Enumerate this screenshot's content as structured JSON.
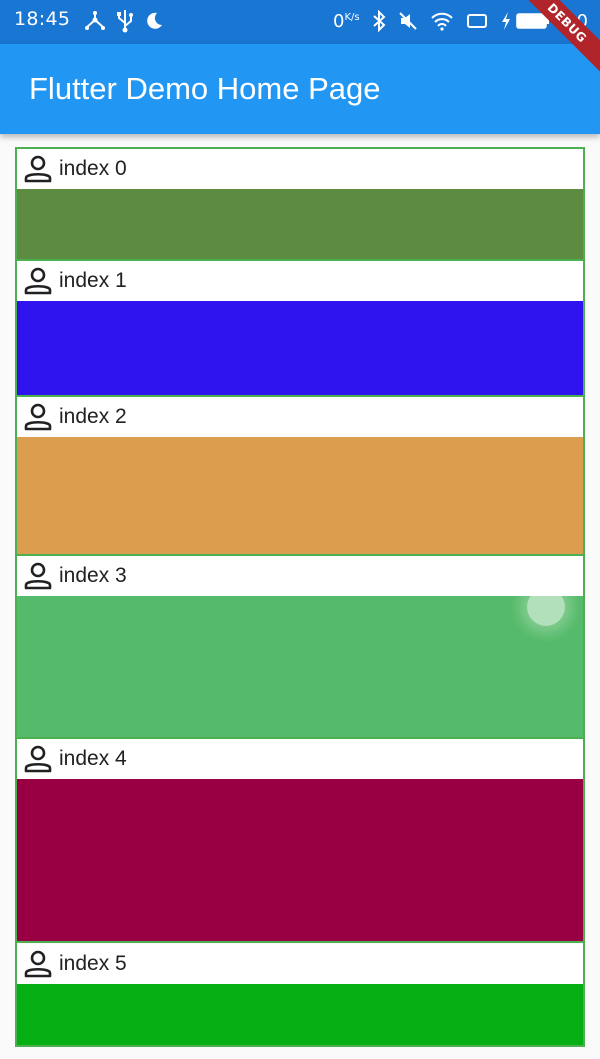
{
  "status_bar": {
    "time": "18:45",
    "net_speed": "0",
    "net_unit": "K/s",
    "battery": "100",
    "icons": [
      "usb-tether-icon",
      "usb-icon",
      "moon-icon",
      "bluetooth-icon",
      "mute-icon",
      "wifi-icon",
      "screen-icon",
      "charging-icon",
      "battery-icon"
    ]
  },
  "app_bar": {
    "title": "Flutter Demo Home Page"
  },
  "debug_banner": "DEBUG",
  "list": {
    "border_color": "#4caf50",
    "items": [
      {
        "label": "index 0",
        "icon": "person-icon",
        "color": "#5e8b42"
      },
      {
        "label": "index 1",
        "icon": "person-icon",
        "color": "#2f14f0"
      },
      {
        "label": "index 2",
        "icon": "person-icon",
        "color": "#db9d4e"
      },
      {
        "label": "index 3",
        "icon": "person-icon",
        "color": "#55ba69"
      },
      {
        "label": "index 4",
        "icon": "person-icon",
        "color": "#990044"
      },
      {
        "label": "index 5",
        "icon": "person-icon",
        "color": "#05b015"
      }
    ]
  }
}
